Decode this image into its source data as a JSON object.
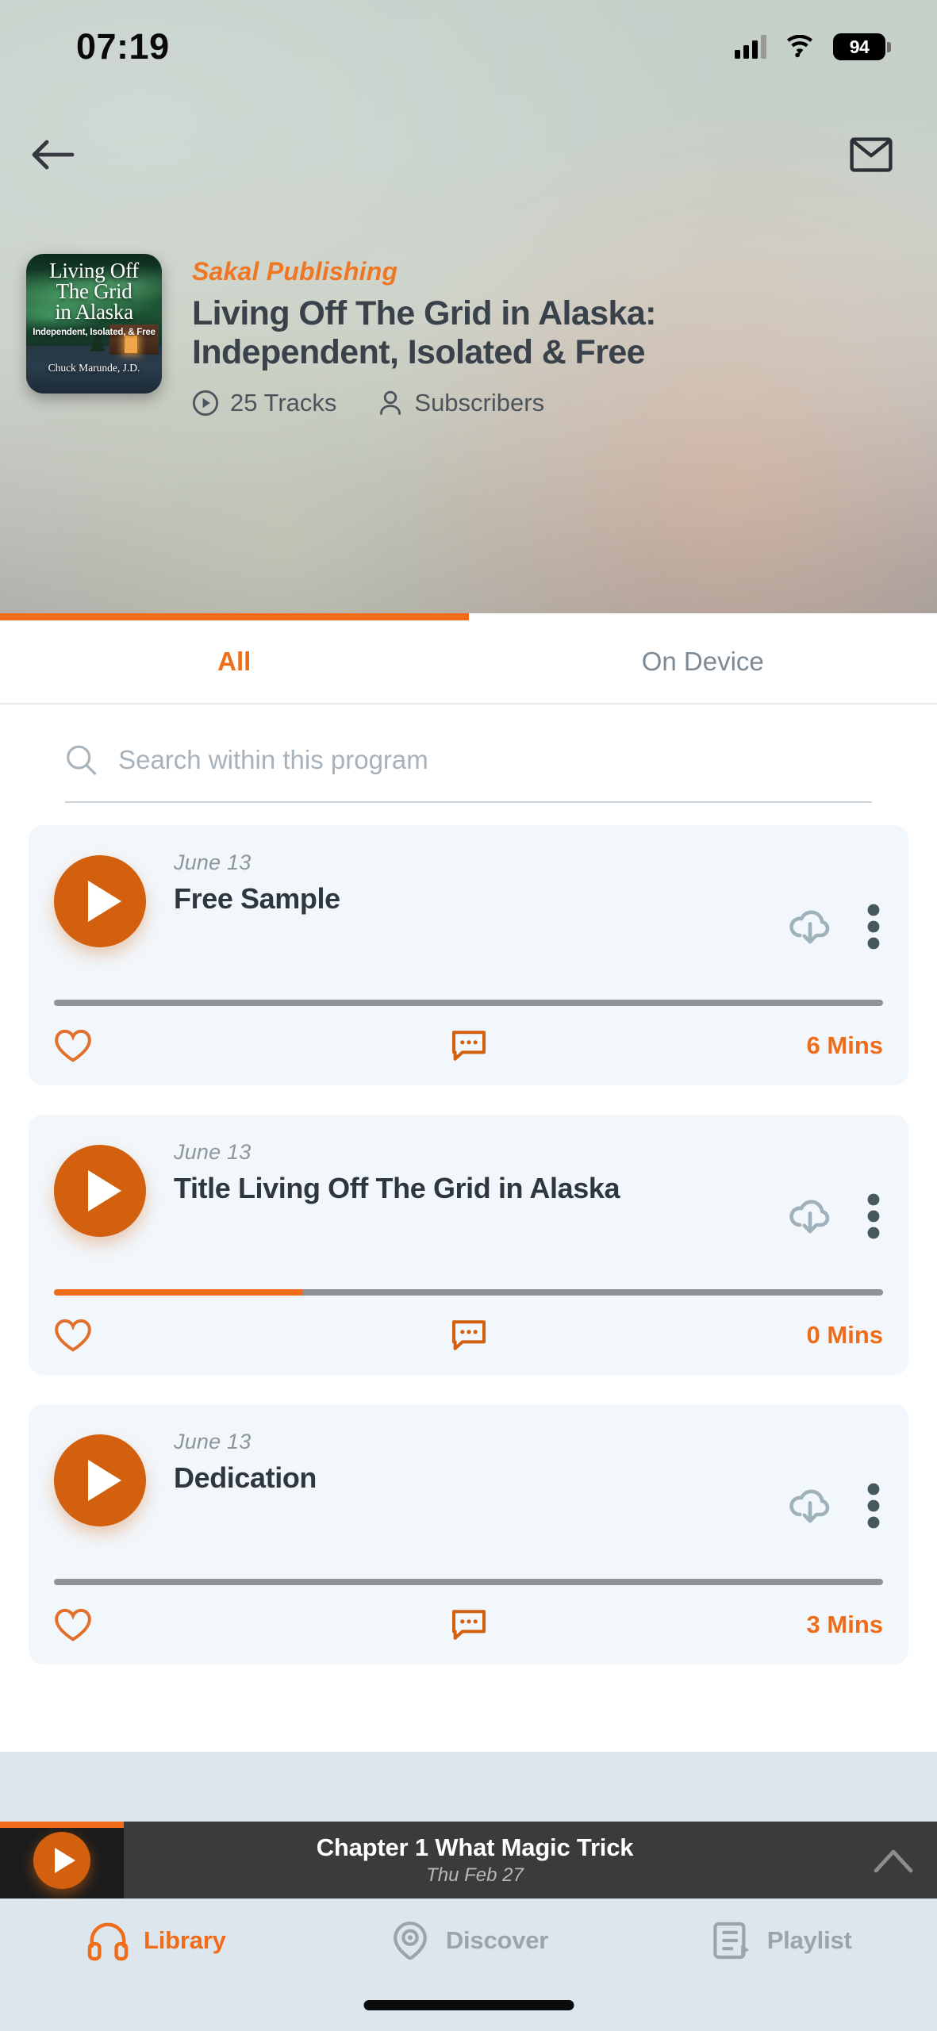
{
  "status_bar": {
    "time": "07:19",
    "battery": "94",
    "signal_icon": "signal-bars-icon",
    "wifi_icon": "wifi-icon",
    "battery_icon": "battery-icon"
  },
  "header": {
    "back_icon": "back-arrow-icon",
    "mail_icon": "envelope-icon",
    "publisher": "Sakal Publishing",
    "title": "Living Off The Grid in Alaska: Independent, Isolated & Free",
    "tracks_label": "25 Tracks",
    "tracks_icon": "play-circle-icon",
    "subscribers_label": "Subscribers",
    "subscribers_icon": "person-icon",
    "cover": {
      "line1": "Living Off",
      "line2": "The Grid",
      "line3": "in Alaska",
      "subtitle": "Independent, Isolated, & Free",
      "author": "Chuck Marunde, J.D."
    }
  },
  "tabs": [
    {
      "label": "All",
      "active": true
    },
    {
      "label": "On Device",
      "active": false
    }
  ],
  "search": {
    "placeholder": "Search within this program",
    "value": "",
    "icon": "search-icon"
  },
  "tracks": [
    {
      "date": "June 13",
      "title": "Free Sample",
      "duration": "6 Mins",
      "progress_percent": 0,
      "download_icon": "cloud-download-icon",
      "menu_icon": "kebab-menu-icon",
      "favorite_icon": "heart-outline-icon",
      "comment_icon": "comment-bubble-icon"
    },
    {
      "date": "June 13",
      "title": "Title Living Off The Grid in Alaska",
      "duration": "0 Mins",
      "progress_percent": 30,
      "download_icon": "cloud-download-icon",
      "menu_icon": "kebab-menu-icon",
      "favorite_icon": "heart-outline-icon",
      "comment_icon": "comment-bubble-icon"
    },
    {
      "date": "June 13",
      "title": "Dedication",
      "duration": "3 Mins",
      "progress_percent": 0,
      "download_icon": "cloud-download-icon",
      "menu_icon": "kebab-menu-icon",
      "favorite_icon": "heart-outline-icon",
      "comment_icon": "comment-bubble-icon"
    }
  ],
  "mini_player": {
    "title": "Chapter 1 What Magic Trick",
    "subtitle": "Thu Feb 27",
    "play_icon": "play-icon",
    "expand_icon": "chevron-up-icon"
  },
  "bottom_nav": [
    {
      "label": "Library",
      "icon": "headphones-icon",
      "active": true
    },
    {
      "label": "Discover",
      "icon": "discover-eye-icon",
      "active": false
    },
    {
      "label": "Playlist",
      "icon": "playlist-icon",
      "active": false
    }
  ],
  "colors": {
    "accent": "#ef6c1a",
    "play_button": "#d2600f",
    "card_bg": "#f2f7fb",
    "nav_bg": "#dde6ec",
    "mini_player_bg": "#3b3b3b"
  }
}
